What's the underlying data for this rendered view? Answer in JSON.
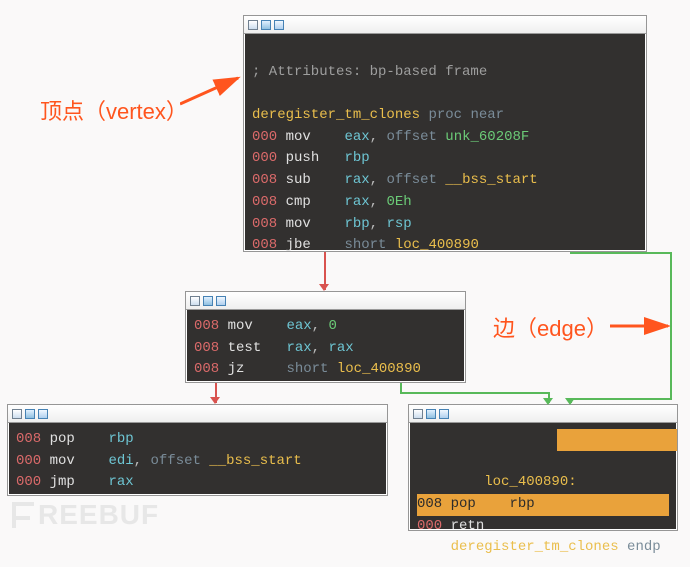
{
  "annotations": {
    "vertex": "顶点（vertex）",
    "edge": "边（edge）"
  },
  "watermark": "REEBUF",
  "panels": {
    "top": {
      "comment": "; Attributes: bp-based frame",
      "proc_name": "deregister_tm_clones",
      "proc_kw": "proc near",
      "rows": [
        {
          "off": "000",
          "op": "mov",
          "a1": "eax",
          "sep": ", ",
          "a2": "offset ",
          "sym": "unk_60208F"
        },
        {
          "off": "000",
          "op": "push",
          "a1": "rbp"
        },
        {
          "off": "008",
          "op": "sub",
          "a1": "rax",
          "sep": ", ",
          "a2": "offset ",
          "sym": "__bss_start"
        },
        {
          "off": "008",
          "op": "cmp",
          "a1": "rax",
          "sep": ", ",
          "lit": "0Eh"
        },
        {
          "off": "008",
          "op": "mov",
          "a1": "rbp",
          "sep": ", ",
          "reg2": "rsp"
        },
        {
          "off": "008",
          "op": "jbe",
          "a2": "short ",
          "sym": "loc_400890"
        }
      ]
    },
    "mid": {
      "rows": [
        {
          "off": "008",
          "op": "mov",
          "a1": "eax",
          "sep": ", ",
          "lit": "0"
        },
        {
          "off": "008",
          "op": "test",
          "a1": "rax",
          "sep": ", ",
          "reg2": "rax"
        },
        {
          "off": "008",
          "op": "jz",
          "a2": "short ",
          "sym": "loc_400890"
        }
      ]
    },
    "left": {
      "rows": [
        {
          "off": "008",
          "op": "pop",
          "a1": "rbp"
        },
        {
          "off": "000",
          "op": "mov",
          "a1": "edi",
          "sep": ", ",
          "a2": "offset ",
          "sym": "__bss_start"
        },
        {
          "off": "000",
          "op": "jmp",
          "a1": "rax"
        }
      ]
    },
    "right": {
      "label": "loc_400890:",
      "rows": [
        {
          "off": "008",
          "op": "pop",
          "a1": "rbp"
        },
        {
          "off": "000",
          "op": "retn"
        }
      ],
      "endp_name": "deregister_tm_clones",
      "endp_kw": "endp"
    }
  }
}
